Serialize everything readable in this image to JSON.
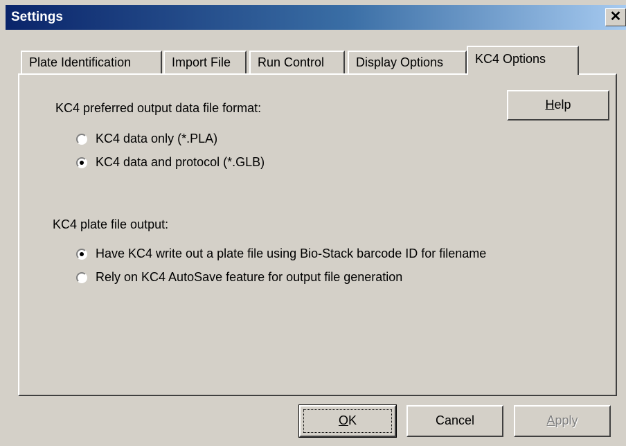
{
  "window": {
    "title": "Settings",
    "close_glyph": "✕"
  },
  "tabs": [
    {
      "label": "Plate Identification",
      "active": false
    },
    {
      "label": "Import File",
      "active": false
    },
    {
      "label": "Run Control",
      "active": false
    },
    {
      "label": "Display Options",
      "active": false
    },
    {
      "label": "KC4 Options",
      "active": true
    }
  ],
  "kc4_options": {
    "format_label": "KC4 preferred output data file format:",
    "format_options": [
      {
        "label": "KC4 data only (*.PLA)",
        "checked": false
      },
      {
        "label": "KC4 data and protocol (*.GLB)",
        "checked": true
      }
    ],
    "output_label": "KC4 plate file output:",
    "output_options": [
      {
        "label": "Have KC4 write out a plate file using Bio-Stack barcode ID for filename",
        "checked": true
      },
      {
        "label": "Rely on KC4 AutoSave feature for output file generation",
        "checked": false
      }
    ],
    "help": {
      "mnemonic": "H",
      "rest": "elp"
    }
  },
  "buttons": {
    "ok": {
      "mnemonic": "O",
      "rest": "K"
    },
    "cancel": "Cancel",
    "apply": {
      "mnemonic": "A",
      "rest": "pply"
    }
  },
  "colors": {
    "title_start": "#0a246a",
    "title_end": "#a6caf0",
    "face": "#d4d0c8"
  }
}
